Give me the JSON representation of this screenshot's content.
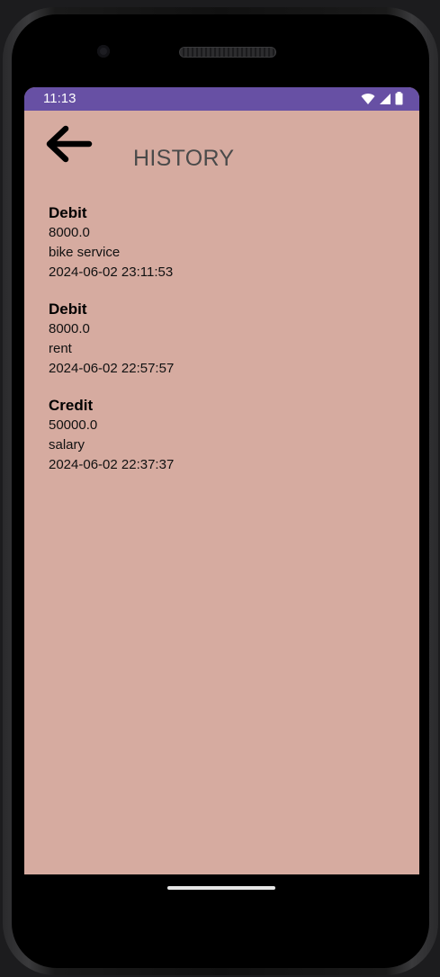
{
  "status_bar": {
    "time": "11:13",
    "icons": [
      "wifi-icon",
      "signal-icon",
      "battery-icon"
    ],
    "color": "#6750a4"
  },
  "header": {
    "title": "HISTORY",
    "back_icon": "arrow-left-icon"
  },
  "theme": {
    "screen_background": "#d6aba0"
  },
  "history": [
    {
      "type": "Debit",
      "amount": "8000.0",
      "description": "bike service",
      "timestamp": "2024-06-02 23:11:53"
    },
    {
      "type": "Debit",
      "amount": "8000.0",
      "description": "rent",
      "timestamp": "2024-06-02 22:57:57"
    },
    {
      "type": "Credit",
      "amount": "50000.0",
      "description": "salary",
      "timestamp": "2024-06-02 22:37:37"
    }
  ]
}
